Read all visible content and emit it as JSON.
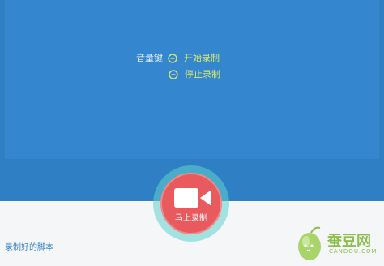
{
  "hints": {
    "volume_key": "音量键",
    "start_recording": "开始录制",
    "stop_recording": "停止录制",
    "start_icon": "minus-circle-icon",
    "stop_icon": "minus-circle-icon"
  },
  "record": {
    "label": "马上录制",
    "icon": "video-camera-icon"
  },
  "footer": {
    "saved_scripts_link": "录制好的脚本"
  },
  "watermark": {
    "name": "蚕豆网",
    "domain": "CANDOU.COM"
  },
  "colors": {
    "background_blue": "#2f7fc4",
    "panel_blue": "#3487cf",
    "record_red": "#e95a5f",
    "halo_teal": "#5fd3cf",
    "hint_yellow": "#d8e66b",
    "footer_bg": "#f4f6f8"
  }
}
